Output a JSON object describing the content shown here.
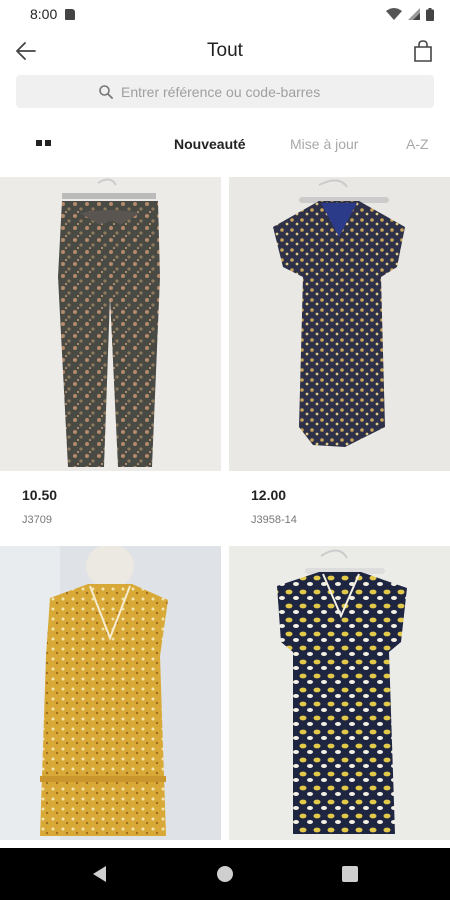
{
  "status_bar": {
    "time": "8:00"
  },
  "header": {
    "title": "Tout"
  },
  "search": {
    "placeholder": "Entrer référence ou code-barres",
    "value": ""
  },
  "sort": {
    "options": [
      {
        "label": "Nouveauté",
        "active": true
      },
      {
        "label": "Mise à jour",
        "active": false
      },
      {
        "label": "A-Z",
        "active": false
      }
    ]
  },
  "products": [
    {
      "price": "10.50",
      "reference": "J3709"
    },
    {
      "price": "12.00",
      "reference": "J3958-14"
    },
    {
      "price": "",
      "reference": ""
    },
    {
      "price": "",
      "reference": ""
    }
  ],
  "colors": {
    "accent": "#222222",
    "inactive_tab": "#a8a8a8",
    "search_bg": "#f0f0f0"
  }
}
